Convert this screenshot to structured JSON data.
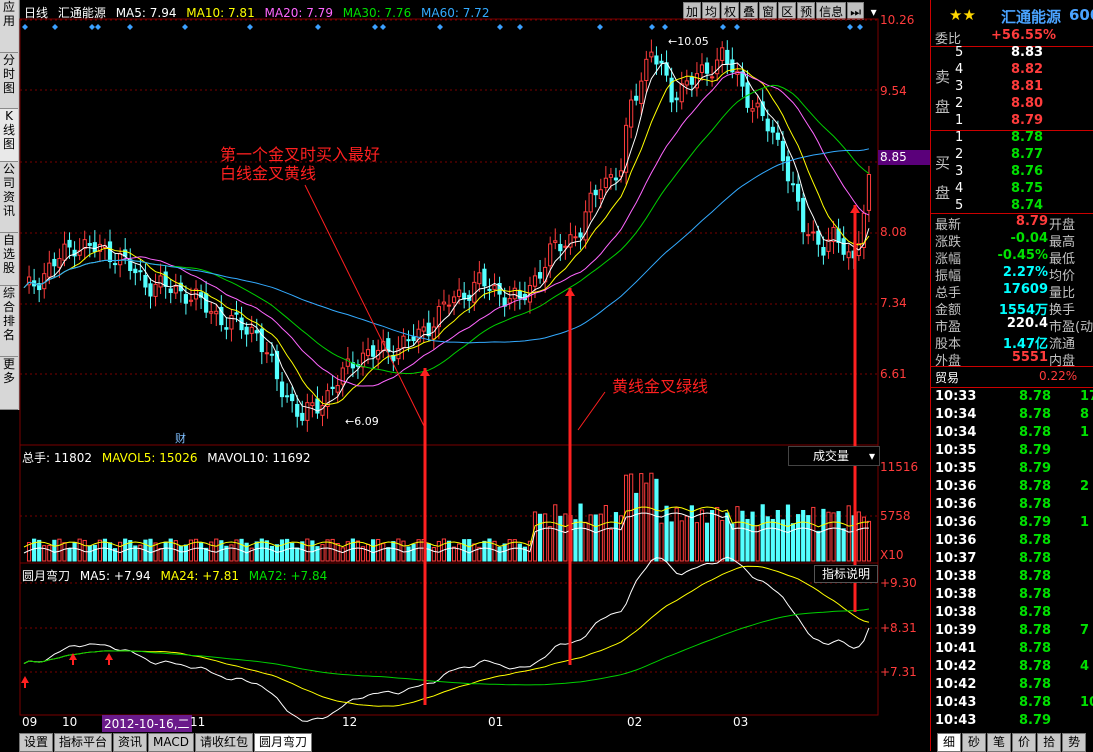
{
  "colors": {
    "up": "#ff3c3c",
    "down": "#54ffff",
    "ma5": "#ffffff",
    "ma10": "#ffff00",
    "ma20": "#ff66ff",
    "ma30": "#00d000",
    "ma60": "#33aaff",
    "grid": "#7a0000",
    "annot": "#ff2020"
  },
  "left_tabs": [
    {
      "label": "应用"
    },
    {
      "label": "分时图"
    },
    {
      "label": "K线图"
    },
    {
      "label": "公司资讯"
    },
    {
      "label": "自选股"
    },
    {
      "label": "综合排名"
    },
    {
      "label": "更多"
    }
  ],
  "toolbar": [
    {
      "label": "加"
    },
    {
      "label": "均"
    },
    {
      "label": "权"
    },
    {
      "label": "叠"
    },
    {
      "label": "窗"
    },
    {
      "label": "区"
    },
    {
      "label": "预"
    },
    {
      "label": "信息"
    },
    {
      "label": "⏭"
    },
    {
      "label": "▾"
    }
  ],
  "main": {
    "title": "日线",
    "stock_name": "汇通能源",
    "ma_legend": [
      {
        "label": "MA5: 7.94"
      },
      {
        "label": "MA10: 7.81"
      },
      {
        "label": "MA20: 7.79"
      },
      {
        "label": "MA30: 7.76"
      },
      {
        "label": "MA60: 7.72"
      }
    ],
    "price_axis": [
      "10.26",
      "9.54",
      "8.85",
      "8.08",
      "7.34",
      "6.61"
    ],
    "current_price": "8.85",
    "high_label": "10.05",
    "low_label": "6.09",
    "cai_label": "财",
    "annotation1_line1": "第一个金叉时买入最好",
    "annotation1_line2": "白线金叉黄线",
    "annotation2": "黄线金叉绿线",
    "date_axis": [
      {
        "label": "09"
      },
      {
        "label": "10"
      },
      {
        "label": "2012-10-16,二"
      },
      {
        "label": "11"
      },
      {
        "label": "12"
      },
      {
        "label": "01"
      },
      {
        "label": "02"
      },
      {
        "label": "03"
      }
    ]
  },
  "volume": {
    "legend": [
      {
        "label": "总手: 11802"
      },
      {
        "label": "MAVOL5: 15026"
      },
      {
        "label": "MAVOL10: 11692"
      }
    ],
    "dropdown": "成交量",
    "axis": [
      "11516",
      "5758",
      "X10"
    ]
  },
  "indicator": {
    "legend": [
      {
        "label": "圆月弯刀"
      },
      {
        "label": "MA5: +7.94"
      },
      {
        "label": "MA24: +7.81"
      },
      {
        "label": "MA72: +7.84"
      }
    ],
    "button": "指标说明",
    "axis": [
      "+9.30",
      "+8.31",
      "+7.31"
    ]
  },
  "bottom_tabs": [
    {
      "label": "设置"
    },
    {
      "label": "指标平台"
    },
    {
      "label": "资讯"
    },
    {
      "label": "MACD"
    },
    {
      "label": "请收红包"
    },
    {
      "label": "圆月弯刀"
    }
  ],
  "side": {
    "stars": "★★",
    "name": "汇通能源",
    "code": "600",
    "weibi_label": "委比",
    "weibi_value": "+56.55%",
    "sell_label": "卖盘",
    "buy_label": "买盘",
    "sells": [
      {
        "n": "5",
        "p": "8.83",
        "v": ""
      },
      {
        "n": "4",
        "p": "8.82",
        "v": ""
      },
      {
        "n": "3",
        "p": "8.81",
        "v": ""
      },
      {
        "n": "2",
        "p": "8.80",
        "v": ""
      },
      {
        "n": "1",
        "p": "8.79",
        "v": ""
      }
    ],
    "buys": [
      {
        "n": "1",
        "p": "8.78",
        "v": ""
      },
      {
        "n": "2",
        "p": "8.77",
        "v": ""
      },
      {
        "n": "3",
        "p": "8.76",
        "v": ""
      },
      {
        "n": "4",
        "p": "8.75",
        "v": ""
      },
      {
        "n": "5",
        "p": "8.74",
        "v": ""
      }
    ],
    "stats": [
      {
        "k": "最新",
        "v": "8.79",
        "k2": "开盘",
        "c": "red"
      },
      {
        "k": "涨跌",
        "v": "-0.04",
        "k2": "最高",
        "c": "green"
      },
      {
        "k": "涨幅",
        "v": "-0.45%",
        "k2": "最低",
        "c": "green"
      },
      {
        "k": "振幅",
        "v": "2.27%",
        "k2": "均价",
        "c": "cyan"
      },
      {
        "k": "总手",
        "v": "17609",
        "k2": "量比",
        "c": "cyan"
      },
      {
        "k": "金额",
        "v": "1554万",
        "k2": "换手",
        "c": "cyan"
      },
      {
        "k": "市盈",
        "v": "220.4",
        "k2": "市盈(动",
        "c": "white"
      },
      {
        "k": "股本",
        "v": "1.47亿",
        "k2": "流通",
        "c": "cyan"
      },
      {
        "k": "外盘",
        "v": "5551",
        "k2": "内盘",
        "c": "red"
      }
    ],
    "trade_label": "贸易",
    "trade_value": "0.22%",
    "ticks": [
      {
        "t": "10:33",
        "p": "8.78",
        "v": "17",
        "c": "green"
      },
      {
        "t": "10:34",
        "p": "8.78",
        "v": "8",
        "c": "green"
      },
      {
        "t": "10:34",
        "p": "8.78",
        "v": "1",
        "c": "green"
      },
      {
        "t": "10:35",
        "p": "8.79",
        "v": "",
        "c": "green"
      },
      {
        "t": "10:35",
        "p": "8.79",
        "v": "",
        "c": "green"
      },
      {
        "t": "10:36",
        "p": "8.78",
        "v": "2",
        "c": "green"
      },
      {
        "t": "10:36",
        "p": "8.78",
        "v": "",
        "c": "green"
      },
      {
        "t": "10:36",
        "p": "8.79",
        "v": "1",
        "c": "green"
      },
      {
        "t": "10:36",
        "p": "8.78",
        "v": "",
        "c": "green"
      },
      {
        "t": "10:37",
        "p": "8.78",
        "v": "",
        "c": "green"
      },
      {
        "t": "10:38",
        "p": "8.78",
        "v": "",
        "c": "green"
      },
      {
        "t": "10:38",
        "p": "8.78",
        "v": "",
        "c": "green"
      },
      {
        "t": "10:38",
        "p": "8.78",
        "v": "",
        "c": "green"
      },
      {
        "t": "10:39",
        "p": "8.78",
        "v": "7",
        "c": "green"
      },
      {
        "t": "10:41",
        "p": "8.78",
        "v": "",
        "c": "green"
      },
      {
        "t": "10:42",
        "p": "8.78",
        "v": "4",
        "c": "green"
      },
      {
        "t": "10:42",
        "p": "8.78",
        "v": "",
        "c": "green"
      },
      {
        "t": "10:43",
        "p": "8.78",
        "v": "10",
        "c": "green"
      },
      {
        "t": "10:43",
        "p": "8.79",
        "v": "",
        "c": "green"
      }
    ],
    "bottom_tabs": [
      {
        "label": "细"
      },
      {
        "label": "砂"
      },
      {
        "label": "笔"
      },
      {
        "label": "价"
      },
      {
        "label": "拾"
      },
      {
        "label": "势"
      }
    ]
  }
}
